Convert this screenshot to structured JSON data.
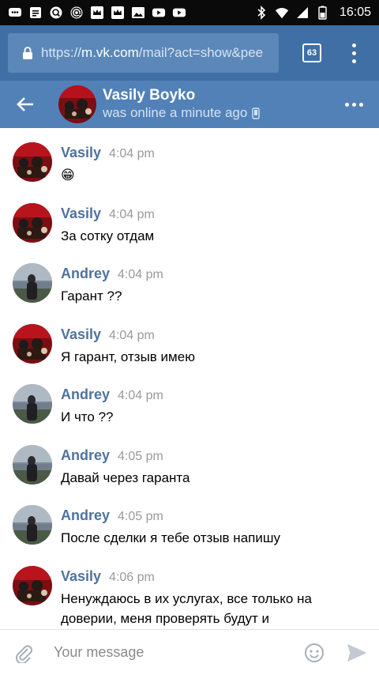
{
  "status_bar": {
    "time": "16:05",
    "icons": [
      "messenger-icon",
      "notes-icon",
      "search-icon",
      "email-at-icon",
      "crown-icon",
      "crown-icon",
      "gallery-icon",
      "youtube-icon",
      "youtube-icon",
      "bluetooth-icon",
      "wifi-icon",
      "signal-icon",
      "battery-icon"
    ]
  },
  "browser": {
    "url_scheme": "https://",
    "url_host": "m.vk.com",
    "url_path": "/mail?act=show&pee",
    "tabs_count": "63"
  },
  "chat_header": {
    "name": "Vasily Boyko",
    "status": "was online a minute ago"
  },
  "messages": [
    {
      "author": "Vasily",
      "time": "4:04 pm",
      "text": "😁",
      "avatar": "vasily"
    },
    {
      "author": "Vasily",
      "time": "4:04 pm",
      "text": "За сотку отдам",
      "avatar": "vasily"
    },
    {
      "author": "Andrey",
      "time": "4:04 pm",
      "text": "Гарант ??",
      "avatar": "andrey"
    },
    {
      "author": "Vasily",
      "time": "4:04 pm",
      "text": "Я гарант, отзыв имею",
      "avatar": "vasily"
    },
    {
      "author": "Andrey",
      "time": "4:04 pm",
      "text": "И что ??",
      "avatar": "andrey"
    },
    {
      "author": "Andrey",
      "time": "4:05 pm",
      "text": "Давай через гаранта",
      "avatar": "andrey"
    },
    {
      "author": "Andrey",
      "time": "4:05 pm",
      "text": "После сделки я тебе отзыв напишу",
      "avatar": "andrey"
    },
    {
      "author": "Vasily",
      "time": "4:06 pm",
      "text": "Ненуждаюсь в их услугах, все только на доверии, меня проверять будут и",
      "avatar": "vasily"
    }
  ],
  "composer": {
    "placeholder": "Your message"
  },
  "colors": {
    "chrome_bar": "#3f6fa5",
    "vk_header": "#5281b8",
    "author": "#4f729f",
    "timestamp": "#999999"
  }
}
